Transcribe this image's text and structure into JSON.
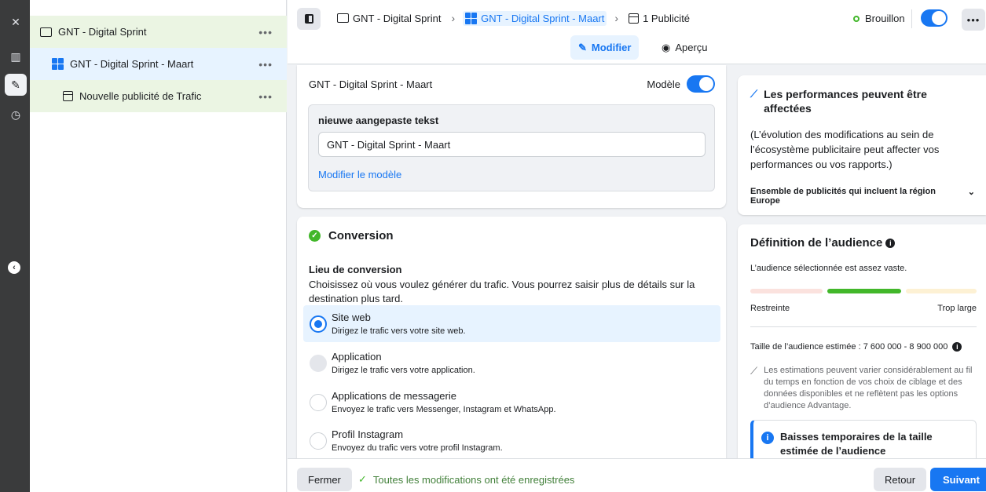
{
  "tree": {
    "items": [
      {
        "label": "GNT - Digital Sprint",
        "more": "•••"
      },
      {
        "label": "GNT - Digital Sprint - Maart",
        "more": "•••"
      },
      {
        "label": "Nouvelle publicité de Trafic",
        "more": "•••"
      }
    ]
  },
  "rail": {
    "close": "✕",
    "chart": "▥",
    "edit": "✎",
    "history": "◷",
    "collapse": "‹"
  },
  "topbar": {
    "breadcrumbs": [
      "GNT - Digital Sprint",
      "GNT - Digital Sprint - Maart",
      "1 Publicité"
    ],
    "separator": "›",
    "status": "Brouillon",
    "more": "•••",
    "edit_label": "Modifier",
    "preview_label": "Aperçu"
  },
  "adset": {
    "name": "GNT - Digital Sprint - Maart",
    "template_toggle_label": "Modèle",
    "template_box_title": "nieuwe aangepaste tekst",
    "template_value": "GNT - Digital Sprint - Maart",
    "edit_template_link": "Modifier le modèle"
  },
  "conversion": {
    "title": "Conversion",
    "location_title": "Lieu de conversion",
    "location_desc": "Choisissez où vous voulez générer du trafic. Vous pourrez saisir plus de détails sur la destination plus tard.",
    "options": [
      {
        "title": "Site web",
        "sub": "Dirigez le trafic vers votre site web."
      },
      {
        "title": "Application",
        "sub": "Dirigez le trafic vers votre application."
      },
      {
        "title": "Applications de messagerie",
        "sub": "Envoyez le trafic vers Messenger, Instagram et WhatsApp."
      },
      {
        "title": "Profil Instagram",
        "sub": "Envoyez du trafic vers votre profil Instagram."
      }
    ]
  },
  "footer": {
    "close_label": "Fermer",
    "saved_text": "Toutes les modifications ont été enregistrées",
    "back_label": "Retour",
    "next_label": "Suivant"
  },
  "performance": {
    "title": "Les performances peuvent être affectées",
    "body": "(L’évolution des modifications au sein de l’écosystème publicitaire peut affecter vos performances ou vos rapports.)",
    "accordion_label": "Ensemble de publicités qui incluent la région Europe"
  },
  "audience": {
    "title": "Définition de l’audience",
    "subtitle": "L’audience sélectionnée est assez vaste.",
    "label_left": "Restreinte",
    "label_right": "Trop large",
    "estimated_size": "Taille de l’audience estimée : 7 600 000 - 8 900 000",
    "note": "Les estimations peuvent varier considérablement au fil du temps en fonction de vos choix de ciblage et des données disponibles et ne reflètent pas les options d’audience Advantage.",
    "alert_title": "Baisses temporaires de la taille estimée de l’audience"
  },
  "colors": {
    "accent": "#1877f2",
    "success": "#42b72a"
  }
}
